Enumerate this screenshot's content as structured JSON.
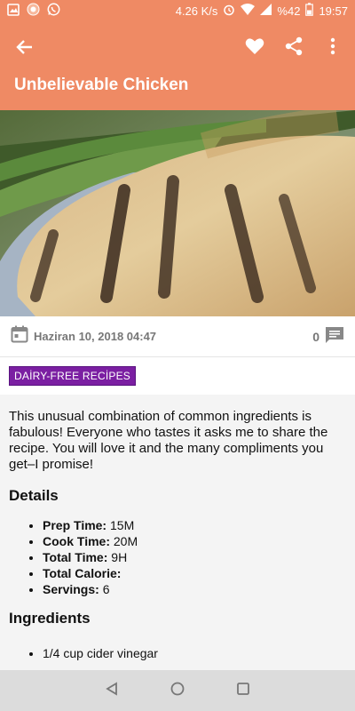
{
  "status_bar": {
    "speed": "4.26 K/s",
    "battery": "%42",
    "time": "19:57"
  },
  "toolbar": {
    "title": "Unbelievable Chicken",
    "icons": [
      "back-arrow-icon",
      "heart-icon",
      "share-icon",
      "more-vert-icon"
    ]
  },
  "meta": {
    "date": "Haziran 10, 2018 04:47",
    "comment_count": "0"
  },
  "category": {
    "label": "DAİRY-FREE RECİPES",
    "color": "#7b1fa2"
  },
  "recipe": {
    "description": "This unusual combination of common ingredients is fabulous! Everyone who tastes it asks me to share the recipe. You will love it and the many compliments you get–I promise!",
    "details_heading": "Details",
    "details": [
      {
        "label": "Prep Time:",
        "value": "15M"
      },
      {
        "label": "Cook Time:",
        "value": "20M"
      },
      {
        "label": "Total Time:",
        "value": "9H"
      },
      {
        "label": "Total Calorie:",
        "value": ""
      },
      {
        "label": "Servings:",
        "value": "6"
      }
    ],
    "ingredients_heading": "Ingredients",
    "ingredients": [
      "1/4 cup cider vinegar"
    ]
  },
  "colors": {
    "accent": "#ef8a64",
    "category": "#7b1fa2"
  }
}
